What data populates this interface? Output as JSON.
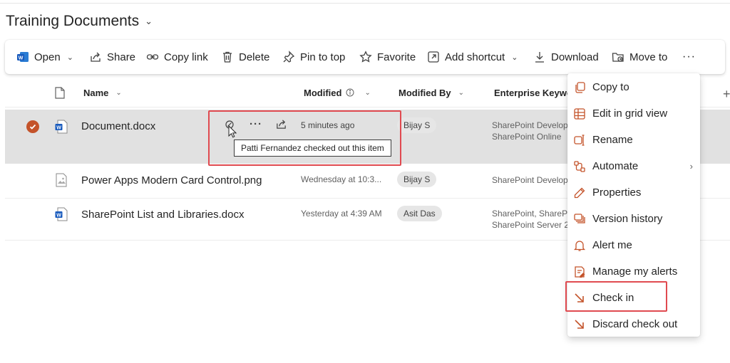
{
  "library": {
    "title": "Training Documents"
  },
  "commands": {
    "open": "Open",
    "share": "Share",
    "copy_link": "Copy link",
    "delete": "Delete",
    "pin_to_top": "Pin to top",
    "favorite": "Favorite",
    "add_shortcut": "Add shortcut",
    "download": "Download",
    "move_to": "Move to",
    "more": "···"
  },
  "columns": {
    "name": "Name",
    "modified": "Modified",
    "modified_by": "Modified By",
    "keywords": "Enterprise Keywords",
    "add_column": "+"
  },
  "rows": [
    {
      "name": "Document.docx",
      "modified": "5 minutes ago",
      "modified_by": "Bijay S",
      "keywords_line1": "SharePoint Development",
      "keywords_line2": "SharePoint Online",
      "selected": true,
      "file_type": "word"
    },
    {
      "name": "Power Apps Modern Card Control.png",
      "modified": "Wednesday at 10:3...",
      "modified_by": "Bijay S",
      "keywords_line1": "SharePoint Development",
      "keywords_line2": "",
      "selected": false,
      "file_type": "image"
    },
    {
      "name": "SharePoint List and Libraries.docx",
      "modified": "Yesterday at 4:39 AM",
      "modified_by": "Asit Das",
      "keywords_line1": "SharePoint, SharePoint",
      "keywords_line2": "SharePoint Server 2019",
      "selected": false,
      "file_type": "word"
    }
  ],
  "tooltip": {
    "text": "Patti Fernandez checked out this item"
  },
  "context_menu": {
    "items": [
      {
        "label": "Copy to",
        "icon": "copy-icon"
      },
      {
        "label": "Edit in grid view",
        "icon": "grid-icon"
      },
      {
        "label": "Rename",
        "icon": "rename-icon"
      },
      {
        "label": "Automate",
        "icon": "automate-icon",
        "has_submenu": true
      },
      {
        "label": "Properties",
        "icon": "pencil-icon"
      },
      {
        "label": "Version history",
        "icon": "version-history-icon"
      },
      {
        "label": "Alert me",
        "icon": "bell-icon"
      },
      {
        "label": "Manage my alerts",
        "icon": "manage-alerts-icon"
      },
      {
        "label": "Check in",
        "icon": "check-in-arrow-icon"
      },
      {
        "label": "Discard check out",
        "icon": "discard-arrow-icon"
      }
    ]
  },
  "colors": {
    "accent": "#c4532a",
    "highlight_box": "#e04a50",
    "selected_row": "#e1e1e1",
    "word_blue": "#185abd"
  }
}
